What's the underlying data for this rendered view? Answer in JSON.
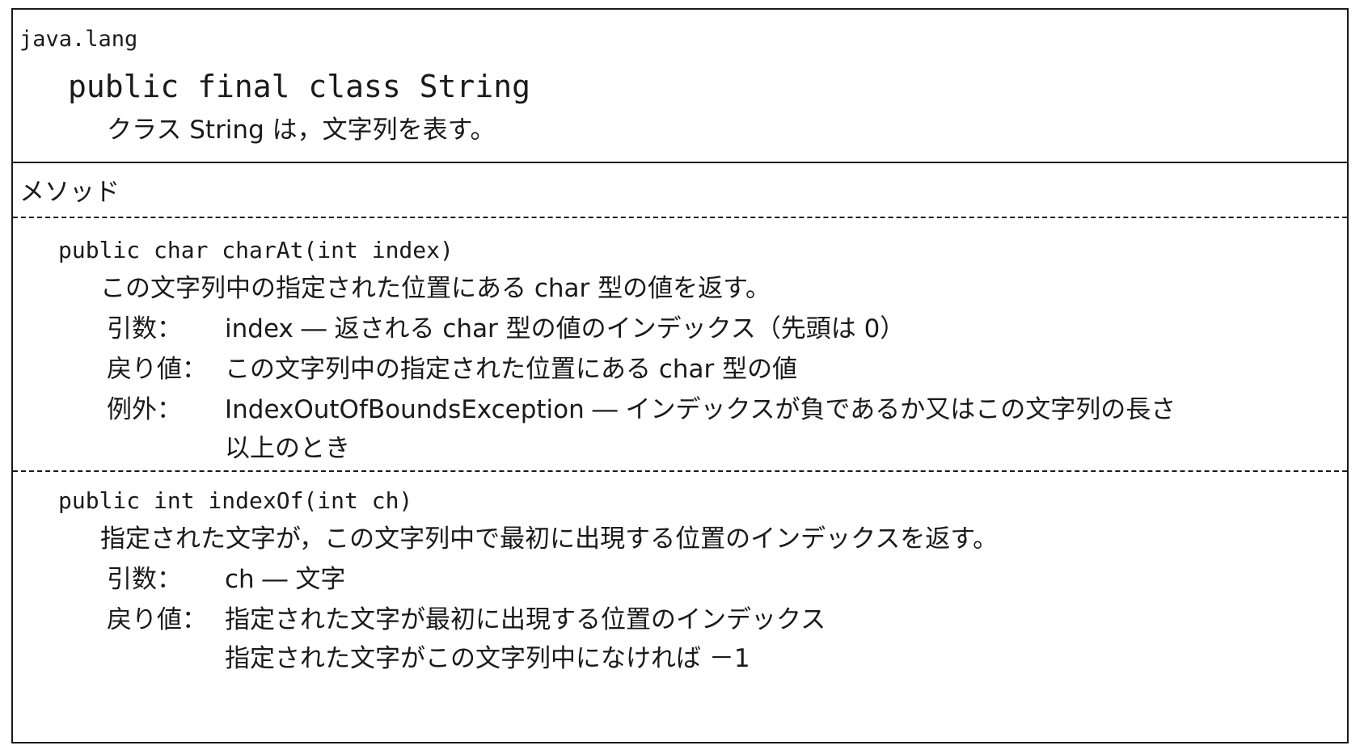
{
  "class_info": {
    "package": "java.lang",
    "declaration": "public final class String",
    "description": "クラス String は，文字列を表す。"
  },
  "methods_section": {
    "heading": "メソッド",
    "methods": [
      {
        "signature": "public char charAt(int index)",
        "description": "この文字列中の指定された位置にある char 型の値を返す。",
        "param_label": "引数：",
        "param_value": "index ― 返される char 型の値のインデックス（先頭は 0）",
        "return_label": "戻り値：",
        "return_value": "この文字列中の指定された位置にある char 型の値",
        "exception_label": "例外：",
        "exception_value_line1": "IndexOutOfBoundsException ― インデックスが負であるか又はこの文字列の長さ",
        "exception_value_line2": "以上のとき"
      },
      {
        "signature": "public int indexOf(int ch)",
        "description": "指定された文字が，この文字列中で最初に出現する位置のインデックスを返す。",
        "param_label": "引数：",
        "param_value": "ch ― 文字",
        "return_label": "戻り値：",
        "return_value_line1": "指定された文字が最初に出現する位置のインデックス",
        "return_value_line2": "指定された文字がこの文字列中になければ －1"
      }
    ]
  }
}
